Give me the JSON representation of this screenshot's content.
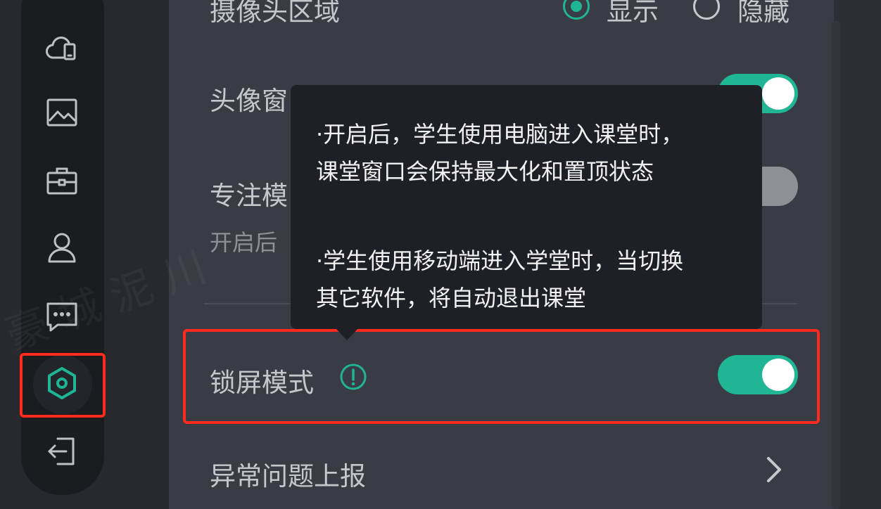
{
  "sidebar": {
    "items": [
      {
        "icon": "cloud-device-icon"
      },
      {
        "icon": "image-icon"
      },
      {
        "icon": "briefcase-icon"
      },
      {
        "icon": "user-icon"
      },
      {
        "icon": "chat-icon"
      },
      {
        "icon": "settings-hexagon-icon",
        "active": true
      },
      {
        "icon": "logout-icon"
      }
    ]
  },
  "settings": {
    "camera_area": {
      "label": "摄像头区域",
      "option_show": "显示",
      "option_hide": "隐藏",
      "selected": "显示"
    },
    "avatar_window": {
      "label": "头像窗",
      "enabled": true
    },
    "focus_mode": {
      "label": "专注模",
      "sub": "开启后",
      "enabled": false
    },
    "lock_screen": {
      "label": "锁屏模式",
      "enabled": true
    },
    "report": {
      "label": "异常问题上报"
    }
  },
  "tooltip": {
    "line1": "·开启后，学生使用电脑进入课堂时，",
    "line2": "课堂窗口会保持最大化和置顶状态",
    "line3": "·学生使用移动端进入学堂时，当切换",
    "line4": "其它软件，将自动退出课堂"
  },
  "colors": {
    "accent": "#1fb595",
    "highlight_box": "#ff2a1e",
    "panel": "#3a3c45",
    "sidebar": "#1b1c20"
  }
}
